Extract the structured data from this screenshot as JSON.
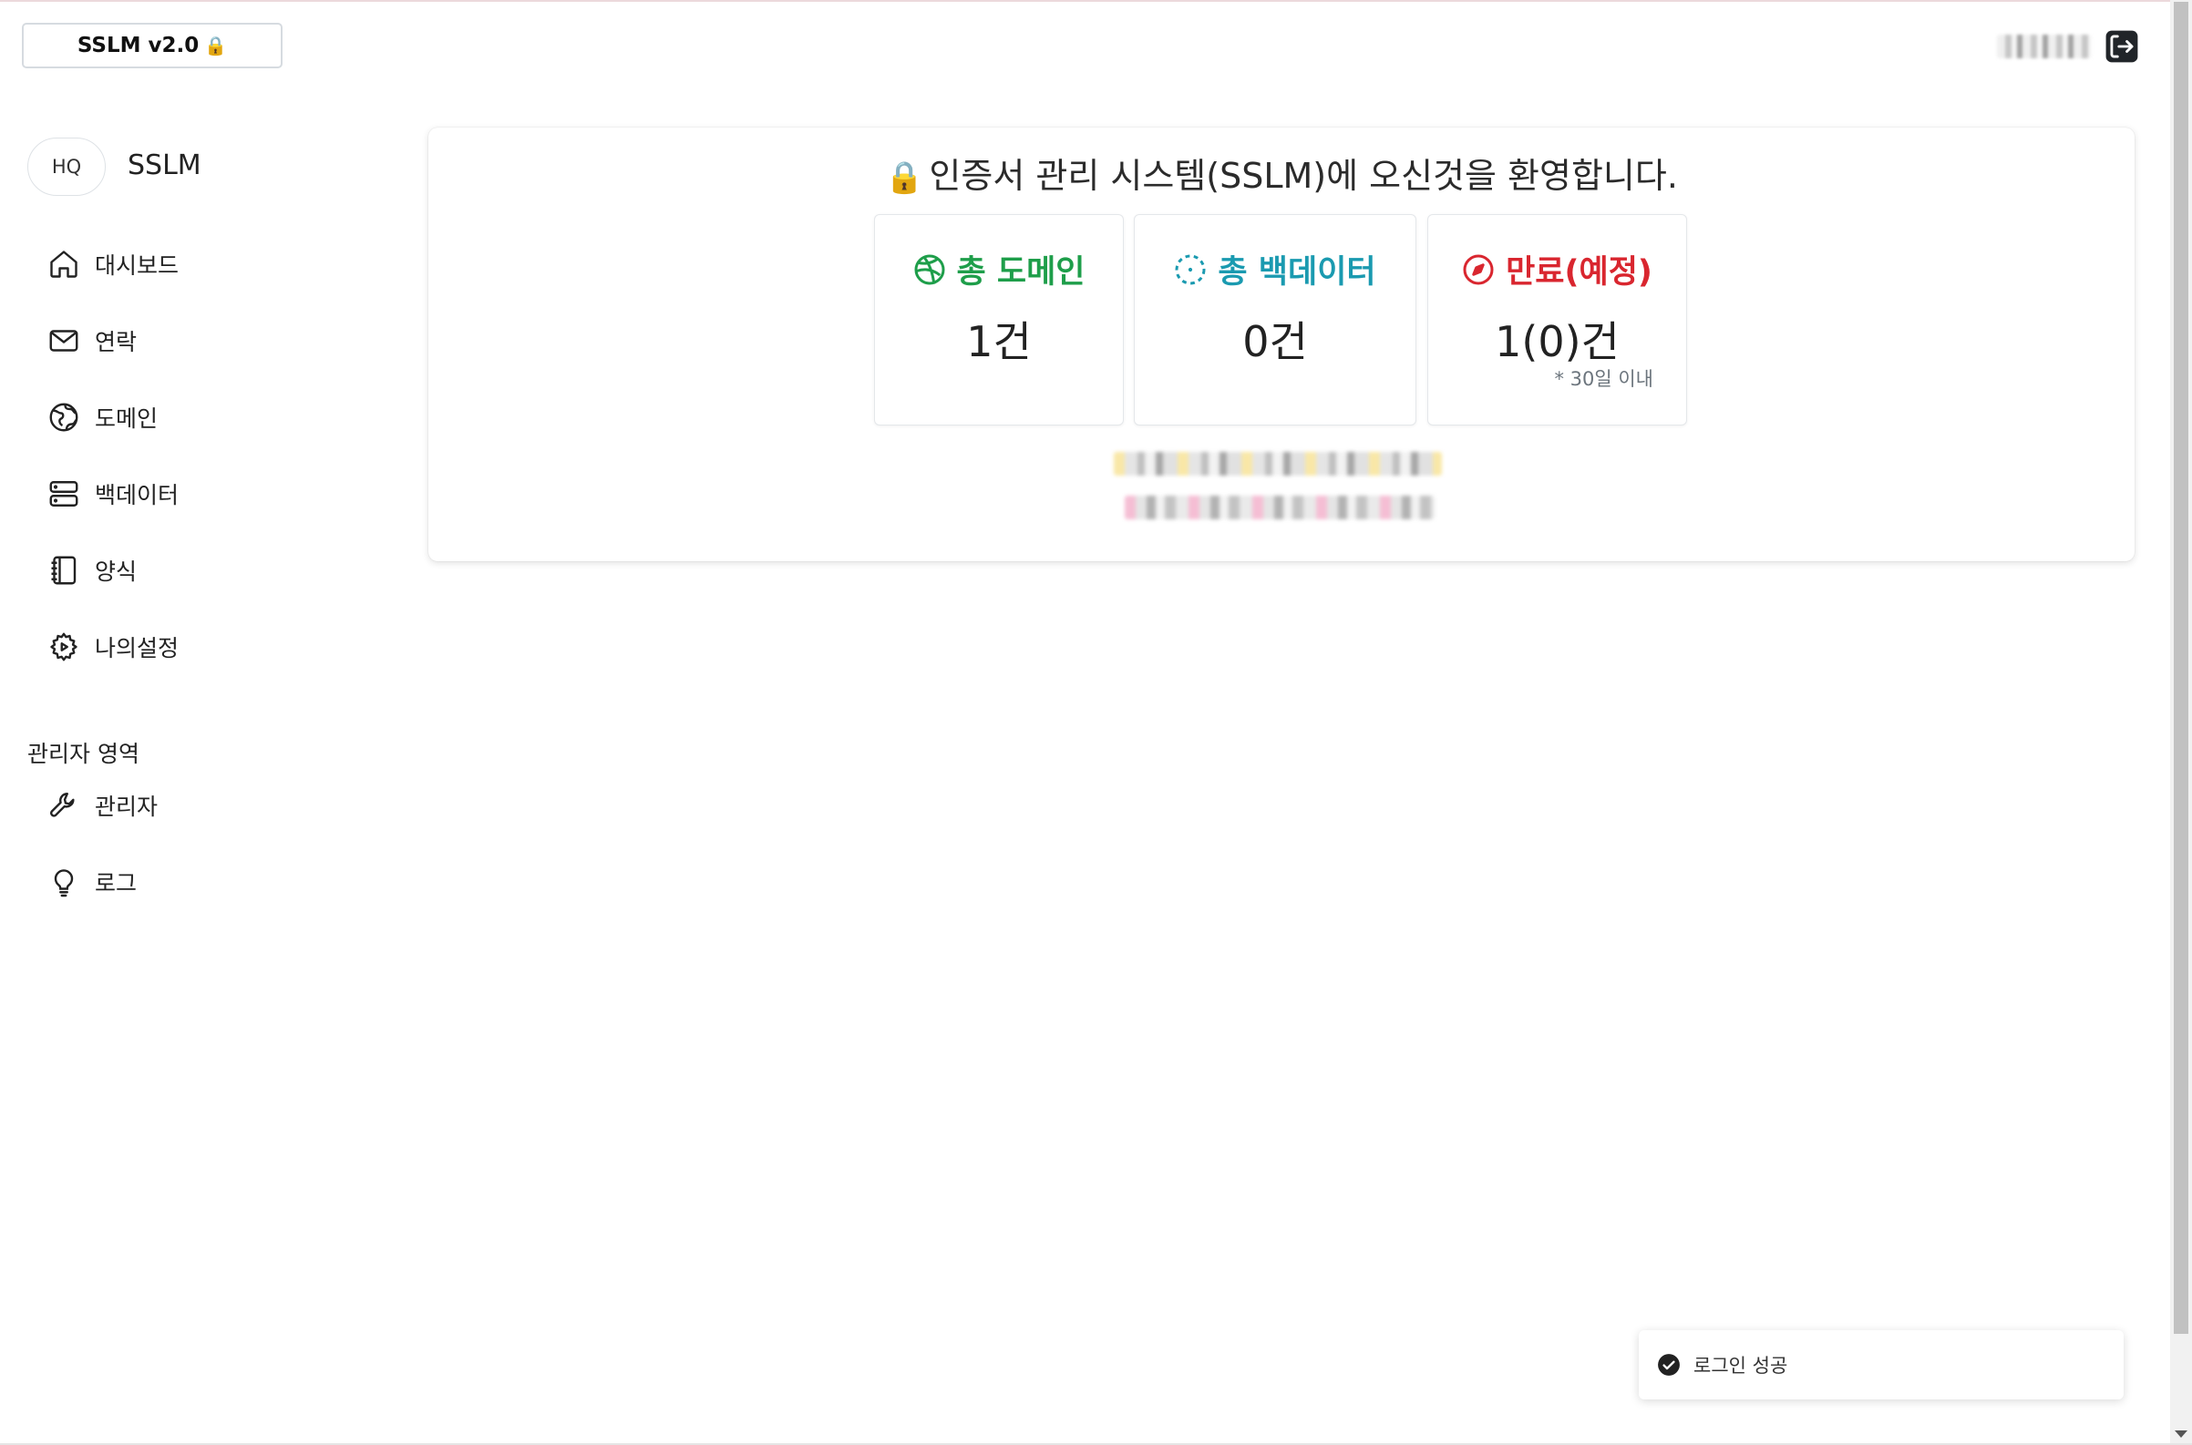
{
  "header": {
    "brand_label": "SSLM v2.0",
    "brand_icon": "lock-emoji",
    "brand_icon_char": "🔒",
    "user_name": "",
    "logout_icon": "logout-icon"
  },
  "sidebar": {
    "avatar_text": "HQ",
    "system_name": "SSLM",
    "items": [
      {
        "label": "대시보드",
        "icon": "home-icon"
      },
      {
        "label": "연락",
        "icon": "mail-icon"
      },
      {
        "label": "도메인",
        "icon": "globe-icon"
      },
      {
        "label": "백데이터",
        "icon": "server-icon"
      },
      {
        "label": "양식",
        "icon": "notebook-icon"
      },
      {
        "label": "나의설정",
        "icon": "gear-icon"
      }
    ],
    "admin_heading": "관리자 영역",
    "admin_items": [
      {
        "label": "관리자",
        "icon": "wrench-icon"
      },
      {
        "label": "로그",
        "icon": "lightbulb-icon"
      }
    ]
  },
  "main": {
    "welcome_icon_char": "🔒",
    "welcome_title": "인증서 관리 시스템(SSLM)에 오신것을 환영합니다.",
    "stats": [
      {
        "title": "총 도메인",
        "value": "1건",
        "color": "#1e9e4a",
        "icon": "dribbble-icon",
        "note": ""
      },
      {
        "title": "총 백데이터",
        "value": "0건",
        "color": "#1a9ab0",
        "icon": "dashed-circle-icon",
        "note": ""
      },
      {
        "title": "만료(예정)",
        "value": "1(0)건",
        "color": "#d9262f",
        "icon": "compass-icon",
        "note": "* 30일 이내"
      }
    ]
  },
  "toast": {
    "message": "로그인 성공",
    "icon": "check-circle-icon"
  }
}
